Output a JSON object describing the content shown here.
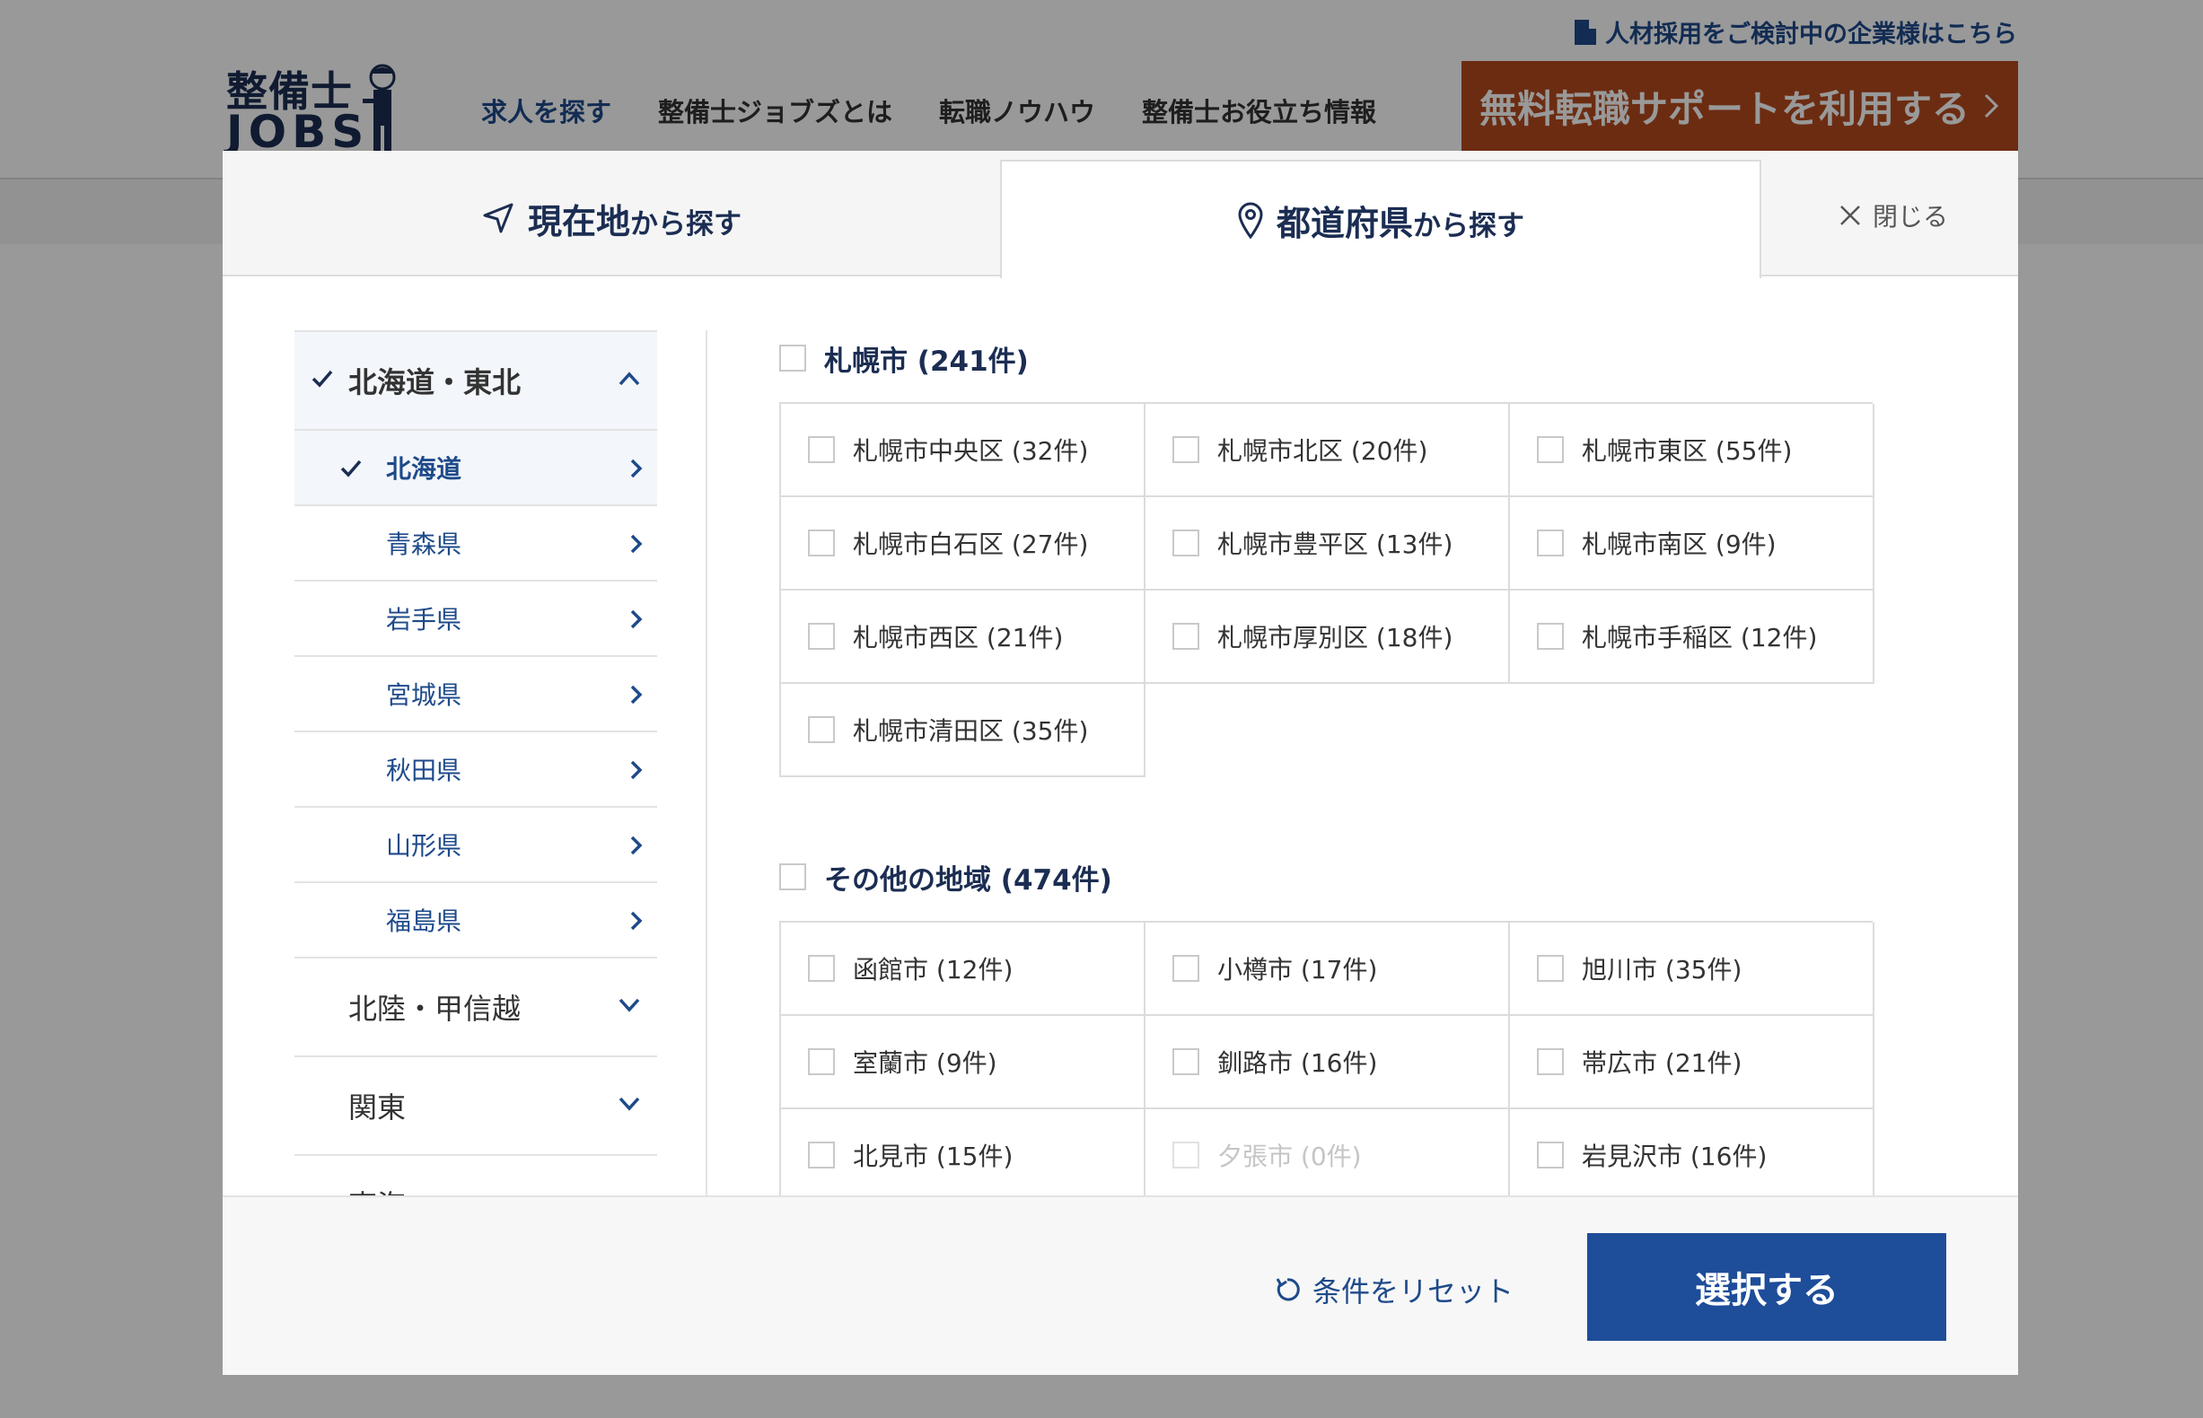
{
  "header": {
    "corporate_link": "人材採用をご検討中の企業様はこちら",
    "logo_line1": "整備士",
    "logo_line2": "JOBS",
    "nav": [
      "求人を探す",
      "整備士ジョブズとは",
      "転職ノウハウ",
      "整備士お役立ち情報"
    ],
    "cta": "無料転職サポートを利用する"
  },
  "modal": {
    "tabs": {
      "current_main": "現在地",
      "current_suffix": "から探す",
      "pref_main": "都道府県",
      "pref_suffix": "から探す"
    },
    "close_label": "閉じる",
    "regions": [
      {
        "label": "北海道・東北",
        "open": true
      },
      {
        "label": "北陸・甲信越",
        "open": false
      },
      {
        "label": "関東",
        "open": false
      },
      {
        "label": "東海",
        "open": false
      }
    ],
    "prefectures": [
      "北海道",
      "青森県",
      "岩手県",
      "宮城県",
      "秋田県",
      "山形県",
      "福島県"
    ],
    "groups": [
      {
        "title": "札幌市 (241件)",
        "cells": [
          "札幌市中央区 (32件)",
          "札幌市北区 (20件)",
          "札幌市東区 (55件)",
          "札幌市白石区 (27件)",
          "札幌市豊平区 (13件)",
          "札幌市南区 (9件)",
          "札幌市西区 (21件)",
          "札幌市厚別区 (18件)",
          "札幌市手稲区 (12件)",
          "札幌市清田区 (35件)"
        ]
      },
      {
        "title": "その他の地域 (474件)",
        "cells": [
          "函館市 (12件)",
          "小樽市 (17件)",
          "旭川市 (35件)",
          "室蘭市 (9件)",
          "釧路市 (16件)",
          "帯広市 (21件)",
          "北見市 (15件)",
          "夕張市 (0件)",
          "岩見沢市 (16件)"
        ]
      }
    ],
    "reset_label": "条件をリセット",
    "submit_label": "選択する"
  },
  "colors": {
    "brand_navy": "#1b2d52",
    "link_blue": "#1e4a8a",
    "submit_blue": "#1e4d99",
    "cta_orange": "#b44a1e"
  }
}
